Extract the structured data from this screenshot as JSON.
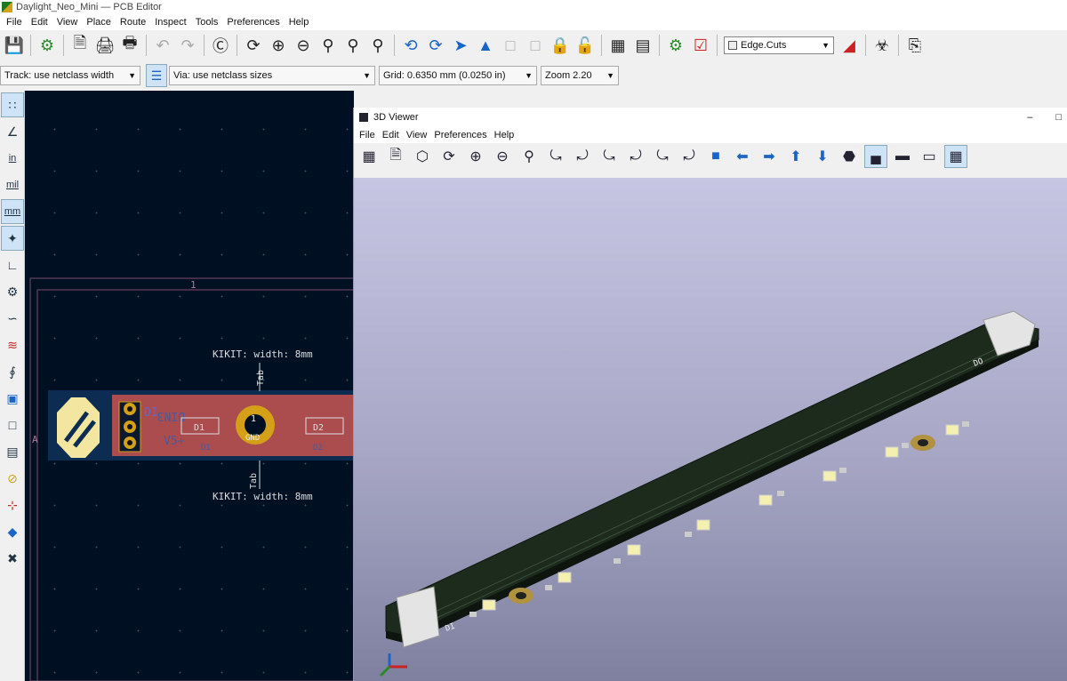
{
  "window": {
    "title": "Daylight_Neo_Mini — PCB Editor"
  },
  "menu": [
    "File",
    "Edit",
    "View",
    "Place",
    "Route",
    "Inspect",
    "Tools",
    "Preferences",
    "Help"
  ],
  "toolbar": {
    "layer_select": "Edge.Cuts"
  },
  "toolbar2": {
    "track": "Track: use netclass width",
    "via": "Via: use netclass sizes",
    "grid": "Grid: 0.6350 mm (0.0250 in)",
    "zoom": "Zoom 2.20"
  },
  "units": {
    "in": "in",
    "mil": "mil",
    "mm": "mm"
  },
  "board": {
    "annotation_top": "KIKIT: width: 8mm",
    "annotation_bottom": "KIKIT: width: 8mm",
    "tab_label": "Tab",
    "sheet_col": "1",
    "sheet_row": "A",
    "ref_d1": "D1",
    "ref_d2": "D2",
    "gnd": "GND",
    "hole": "1",
    "silk_rev": "DIN3",
    "silk_v": "V5+",
    "silk_dl": "DI"
  },
  "viewer": {
    "title": "3D Viewer",
    "menu": [
      "File",
      "Edit",
      "View",
      "Preferences",
      "Help"
    ],
    "strip": {
      "label_di": "DI",
      "label_do": "DO"
    }
  },
  "colors": {
    "canvas_bg": "#001023",
    "board_copper": "#c8524f",
    "pcb_green": "#1d2b1d",
    "viewer_bg_top": "#c6c6e3",
    "viewer_bg_bottom": "#7f7fa0"
  }
}
